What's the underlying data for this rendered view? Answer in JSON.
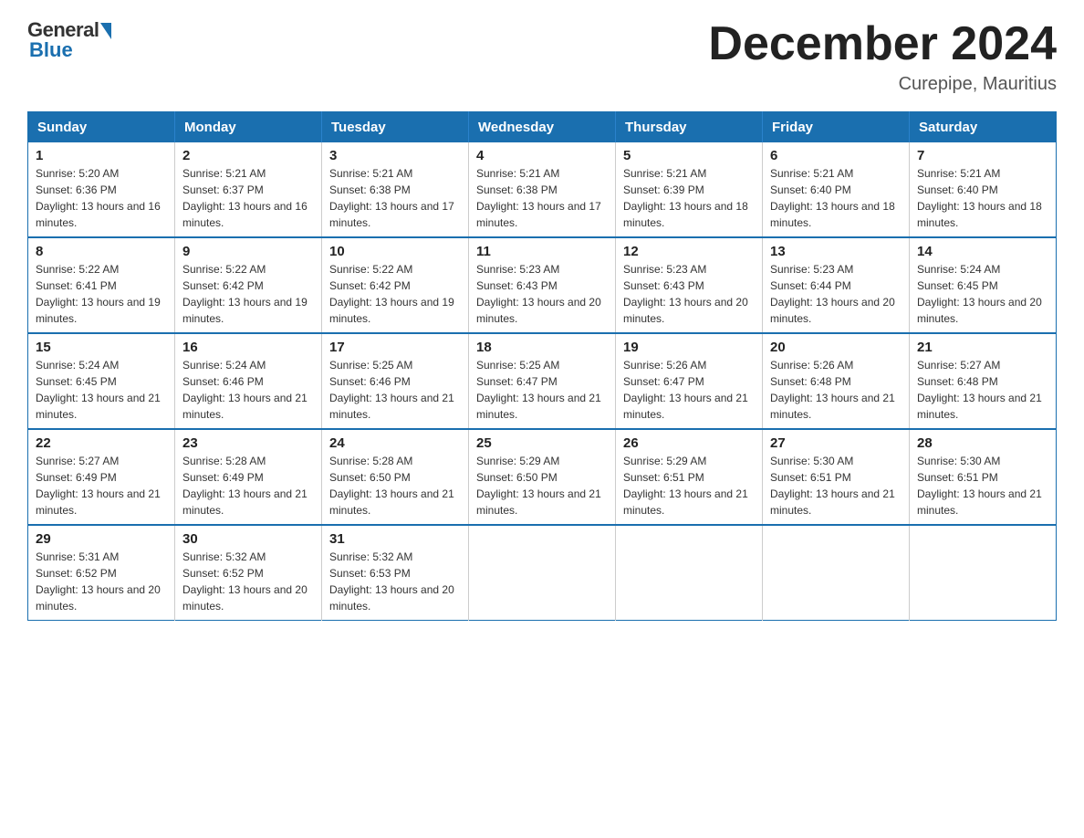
{
  "header": {
    "logo_general": "General",
    "logo_blue": "Blue",
    "month_year": "December 2024",
    "location": "Curepipe, Mauritius"
  },
  "calendar": {
    "days_of_week": [
      "Sunday",
      "Monday",
      "Tuesday",
      "Wednesday",
      "Thursday",
      "Friday",
      "Saturday"
    ],
    "weeks": [
      [
        {
          "day": "1",
          "sunrise": "5:20 AM",
          "sunset": "6:36 PM",
          "daylight": "13 hours and 16 minutes."
        },
        {
          "day": "2",
          "sunrise": "5:21 AM",
          "sunset": "6:37 PM",
          "daylight": "13 hours and 16 minutes."
        },
        {
          "day": "3",
          "sunrise": "5:21 AM",
          "sunset": "6:38 PM",
          "daylight": "13 hours and 17 minutes."
        },
        {
          "day": "4",
          "sunrise": "5:21 AM",
          "sunset": "6:38 PM",
          "daylight": "13 hours and 17 minutes."
        },
        {
          "day": "5",
          "sunrise": "5:21 AM",
          "sunset": "6:39 PM",
          "daylight": "13 hours and 18 minutes."
        },
        {
          "day": "6",
          "sunrise": "5:21 AM",
          "sunset": "6:40 PM",
          "daylight": "13 hours and 18 minutes."
        },
        {
          "day": "7",
          "sunrise": "5:21 AM",
          "sunset": "6:40 PM",
          "daylight": "13 hours and 18 minutes."
        }
      ],
      [
        {
          "day": "8",
          "sunrise": "5:22 AM",
          "sunset": "6:41 PM",
          "daylight": "13 hours and 19 minutes."
        },
        {
          "day": "9",
          "sunrise": "5:22 AM",
          "sunset": "6:42 PM",
          "daylight": "13 hours and 19 minutes."
        },
        {
          "day": "10",
          "sunrise": "5:22 AM",
          "sunset": "6:42 PM",
          "daylight": "13 hours and 19 minutes."
        },
        {
          "day": "11",
          "sunrise": "5:23 AM",
          "sunset": "6:43 PM",
          "daylight": "13 hours and 20 minutes."
        },
        {
          "day": "12",
          "sunrise": "5:23 AM",
          "sunset": "6:43 PM",
          "daylight": "13 hours and 20 minutes."
        },
        {
          "day": "13",
          "sunrise": "5:23 AM",
          "sunset": "6:44 PM",
          "daylight": "13 hours and 20 minutes."
        },
        {
          "day": "14",
          "sunrise": "5:24 AM",
          "sunset": "6:45 PM",
          "daylight": "13 hours and 20 minutes."
        }
      ],
      [
        {
          "day": "15",
          "sunrise": "5:24 AM",
          "sunset": "6:45 PM",
          "daylight": "13 hours and 21 minutes."
        },
        {
          "day": "16",
          "sunrise": "5:24 AM",
          "sunset": "6:46 PM",
          "daylight": "13 hours and 21 minutes."
        },
        {
          "day": "17",
          "sunrise": "5:25 AM",
          "sunset": "6:46 PM",
          "daylight": "13 hours and 21 minutes."
        },
        {
          "day": "18",
          "sunrise": "5:25 AM",
          "sunset": "6:47 PM",
          "daylight": "13 hours and 21 minutes."
        },
        {
          "day": "19",
          "sunrise": "5:26 AM",
          "sunset": "6:47 PM",
          "daylight": "13 hours and 21 minutes."
        },
        {
          "day": "20",
          "sunrise": "5:26 AM",
          "sunset": "6:48 PM",
          "daylight": "13 hours and 21 minutes."
        },
        {
          "day": "21",
          "sunrise": "5:27 AM",
          "sunset": "6:48 PM",
          "daylight": "13 hours and 21 minutes."
        }
      ],
      [
        {
          "day": "22",
          "sunrise": "5:27 AM",
          "sunset": "6:49 PM",
          "daylight": "13 hours and 21 minutes."
        },
        {
          "day": "23",
          "sunrise": "5:28 AM",
          "sunset": "6:49 PM",
          "daylight": "13 hours and 21 minutes."
        },
        {
          "day": "24",
          "sunrise": "5:28 AM",
          "sunset": "6:50 PM",
          "daylight": "13 hours and 21 minutes."
        },
        {
          "day": "25",
          "sunrise": "5:29 AM",
          "sunset": "6:50 PM",
          "daylight": "13 hours and 21 minutes."
        },
        {
          "day": "26",
          "sunrise": "5:29 AM",
          "sunset": "6:51 PM",
          "daylight": "13 hours and 21 minutes."
        },
        {
          "day": "27",
          "sunrise": "5:30 AM",
          "sunset": "6:51 PM",
          "daylight": "13 hours and 21 minutes."
        },
        {
          "day": "28",
          "sunrise": "5:30 AM",
          "sunset": "6:51 PM",
          "daylight": "13 hours and 21 minutes."
        }
      ],
      [
        {
          "day": "29",
          "sunrise": "5:31 AM",
          "sunset": "6:52 PM",
          "daylight": "13 hours and 20 minutes."
        },
        {
          "day": "30",
          "sunrise": "5:32 AM",
          "sunset": "6:52 PM",
          "daylight": "13 hours and 20 minutes."
        },
        {
          "day": "31",
          "sunrise": "5:32 AM",
          "sunset": "6:53 PM",
          "daylight": "13 hours and 20 minutes."
        },
        null,
        null,
        null,
        null
      ]
    ]
  }
}
